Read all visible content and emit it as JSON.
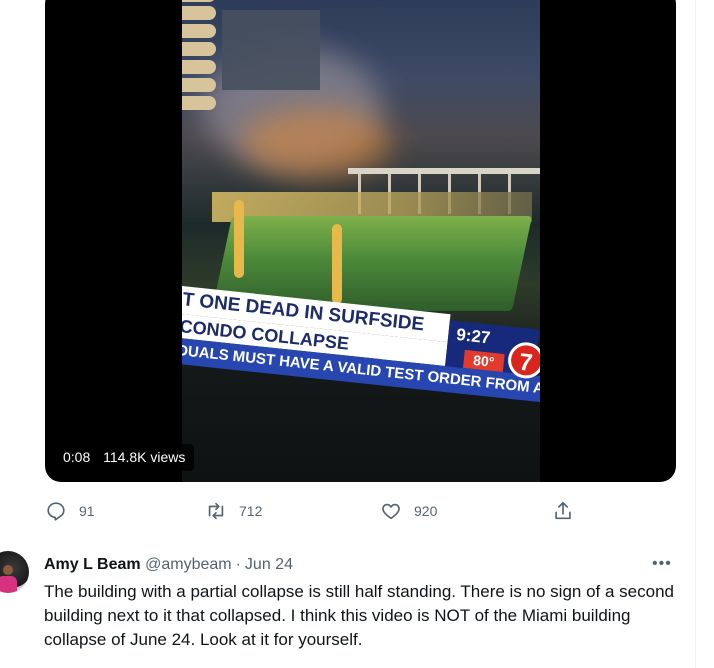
{
  "video": {
    "ticker_line1": "T ONE DEAD IN SURFSIDE",
    "ticker_line2": "CONDO COLLAPSE",
    "ticker_line3": "DUALS MUST HAVE A VALID TEST ORDER FROM A L",
    "ticker_time": "9:27",
    "ticker_temp": "80°",
    "logo_digit": "7",
    "duration": "0:08",
    "views": "114.8K views"
  },
  "actions": {
    "reply_count": "91",
    "retweet_count": "712",
    "like_count": "920",
    "icons": [
      "reply-icon",
      "retweet-icon",
      "like-icon",
      "share-icon"
    ]
  },
  "reply": {
    "name": "Amy L Beam",
    "handle": "@amybeam",
    "separator": "·",
    "date": "Jun 24",
    "more": "•••",
    "text": "The building with a partial collapse is still half standing.  There is no sign of a second building next to it that collapsed.  I think this video is NOT of the Miami building collapse of June 24.  Look at it for yourself."
  },
  "colors": {
    "muted_text": "#536471",
    "primary_text": "#0f1419",
    "ticker_blue": "#2746b0",
    "ticker_red": "#d9251c"
  }
}
